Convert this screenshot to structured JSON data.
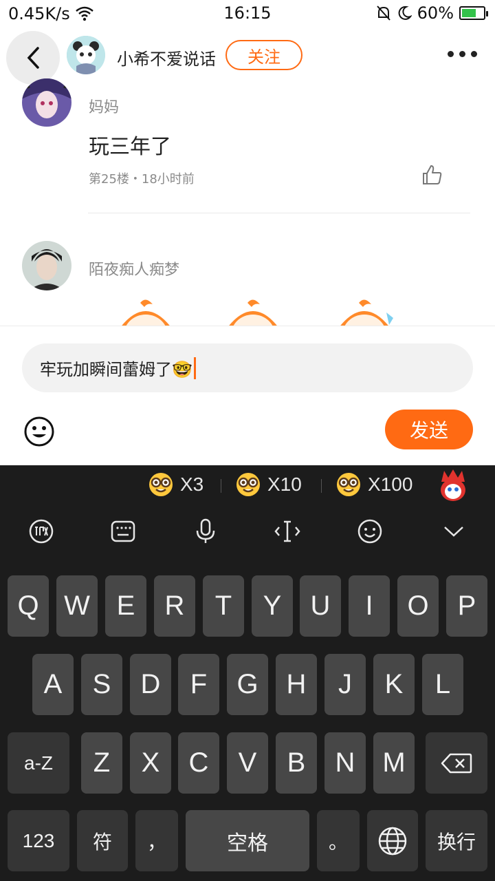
{
  "status_bar": {
    "network_speed": "0.45K/s",
    "time": "16:15",
    "battery": "60%"
  },
  "header": {
    "username": "小希不爱说话",
    "follow_label": "关注"
  },
  "comments": [
    {
      "name": "妈妈",
      "text": "玩三年了",
      "meta": "第25楼・18小时前"
    },
    {
      "name": "陌夜痴人痴梦"
    }
  ],
  "input": {
    "value": "牢玩加瞬间蕾姆了🤓"
  },
  "send_label": "发送",
  "keyboard": {
    "suggestions": [
      "X3",
      "X10",
      "X100"
    ],
    "row1": [
      "Q",
      "W",
      "E",
      "R",
      "T",
      "Y",
      "U",
      "I",
      "O",
      "P"
    ],
    "row2": [
      "A",
      "S",
      "D",
      "F",
      "G",
      "H",
      "J",
      "K",
      "L"
    ],
    "row3": [
      "Z",
      "X",
      "C",
      "V",
      "B",
      "N",
      "M"
    ],
    "shift_label": "a-Z",
    "num_label": "123",
    "symbol_label": "符",
    "comma_label": "，",
    "space_label": "空格",
    "period_label": "。",
    "enter_label": "换行"
  },
  "colors": {
    "accent": "#ff6a13",
    "keyboard_bg": "#1c1c1c",
    "key_bg": "#474747"
  }
}
